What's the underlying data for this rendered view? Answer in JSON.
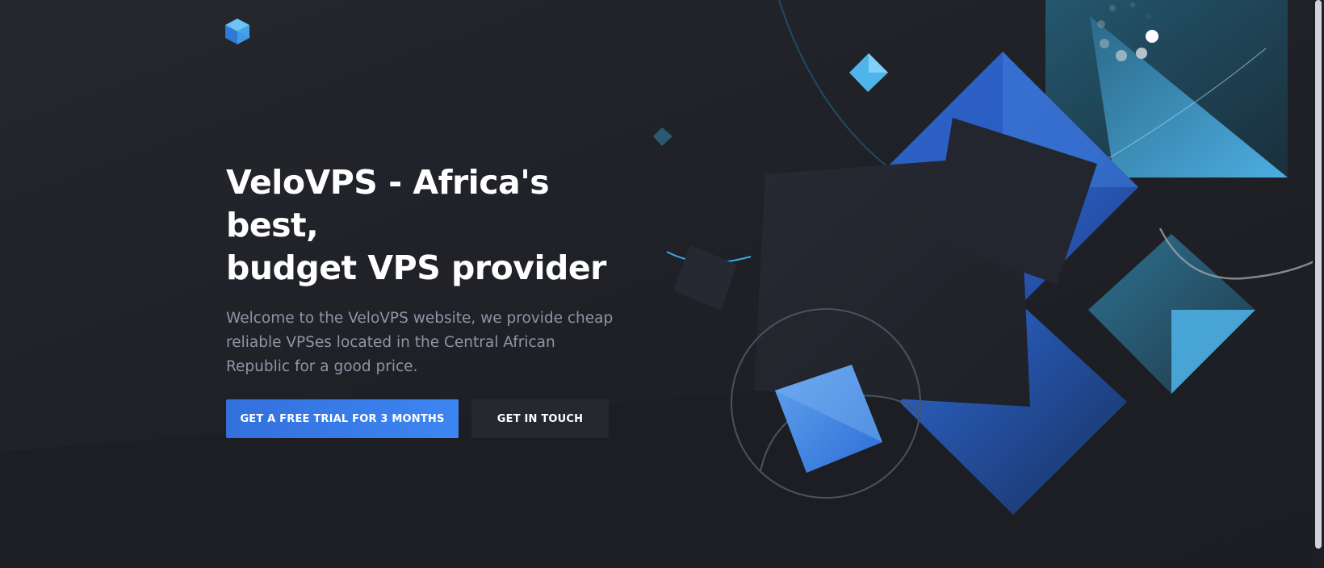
{
  "brand": {
    "logo_icon": "cube-logo-icon"
  },
  "hero": {
    "title_line1": "VeloVPS - Africa's best,",
    "title_line2": "budget VPS provider",
    "description": "Welcome to the VeloVPS website, we provide cheap reliable VPSes located in the Central African Republic for a good price."
  },
  "actions": {
    "primary_label": "GET A FREE TRIAL FOR 3 MONTHS",
    "secondary_label": "GET IN TOUCH"
  },
  "colors": {
    "background": "#1d1f25",
    "primary_button": "#3479e8",
    "secondary_button": "#262830",
    "accent_blue": "#2f6fd6",
    "accent_cyan": "#4fb4ea"
  }
}
